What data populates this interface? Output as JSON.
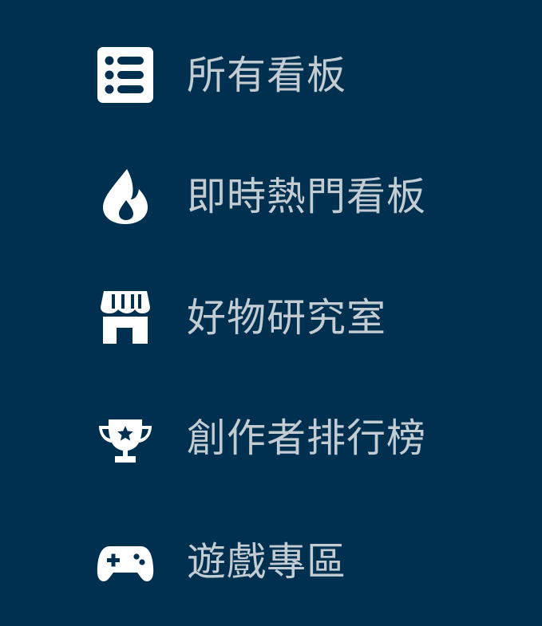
{
  "menu": {
    "items": [
      {
        "label": "所有看板",
        "icon": "list-icon"
      },
      {
        "label": "即時熱門看板",
        "icon": "fire-icon"
      },
      {
        "label": "好物研究室",
        "icon": "store-icon"
      },
      {
        "label": "創作者排行榜",
        "icon": "trophy-icon"
      },
      {
        "label": "遊戲專區",
        "icon": "gamepad-icon"
      }
    ]
  },
  "colors": {
    "background": "#00304f",
    "label": "#c3ccd3",
    "icon": "#ffffff"
  }
}
